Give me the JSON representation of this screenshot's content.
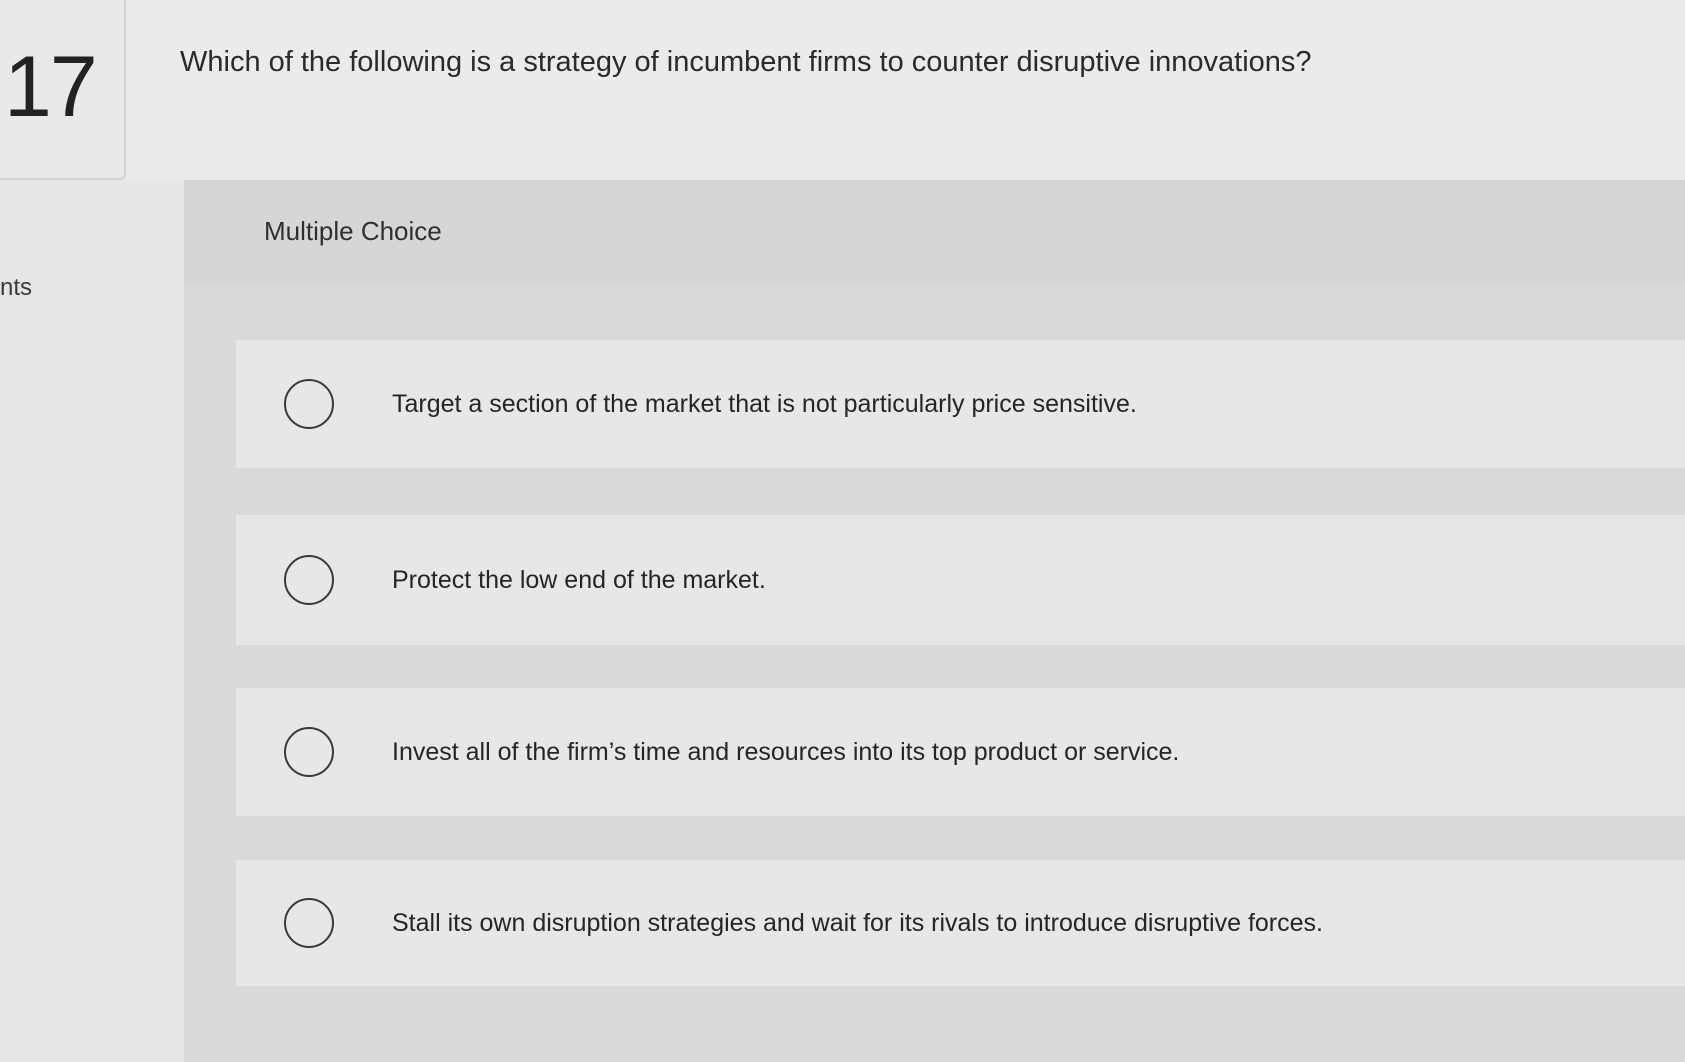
{
  "question": {
    "number": "17",
    "points_label": "nts",
    "prompt": "Which of the following is a strategy of incumbent firms to counter disruptive innovations?",
    "type_label": "Multiple Choice"
  },
  "options": [
    {
      "label": "Target a section of the market that is not particularly price sensitive."
    },
    {
      "label": "Protect the low end of the market."
    },
    {
      "label": "Invest all of the firm’s time and resources into its top product or service."
    },
    {
      "label": "Stall its own disruption strategies and wait for its rivals to introduce disruptive forces."
    }
  ]
}
